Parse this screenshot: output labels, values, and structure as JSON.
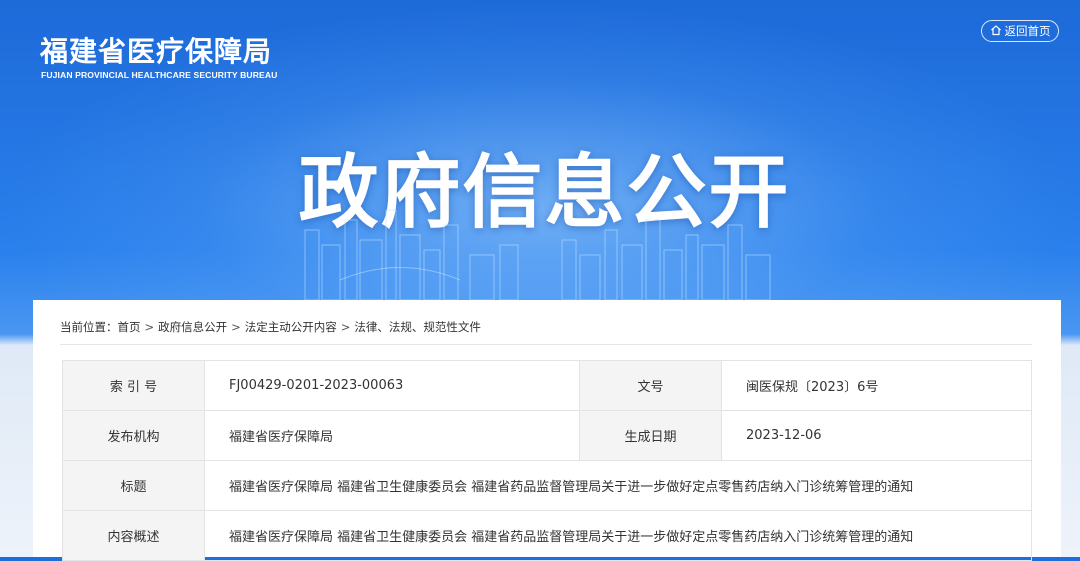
{
  "header": {
    "logo_cn": "福建省医疗保障局",
    "logo_en": "FUJIAN PROVINCIAL HEALTHCARE SECURITY BUREAU",
    "home_button": "返回首页",
    "home_icon": "home-icon"
  },
  "hero": {
    "title": "政府信息公开"
  },
  "breadcrumb": {
    "prefix": "当前位置：",
    "items": [
      "首页",
      "政府信息公开",
      "法定主动公开内容",
      "法律、法规、规范性文件"
    ],
    "separator": ">"
  },
  "meta": {
    "index_label": "索 引 号",
    "index_value": "FJ00429-0201-2023-00063",
    "docno_label": "文号",
    "docno_value": "闽医保规〔2023〕6号",
    "publisher_label": "发布机构",
    "publisher_value": "福建省医疗保障局",
    "date_label": "生成日期",
    "date_value": "2023-12-06",
    "title_label": "标题",
    "title_value": "福建省医疗保障局 福建省卫生健康委员会 福建省药品监督管理局关于进一步做好定点零售药店纳入门诊统筹管理的通知",
    "summary_label": "内容概述",
    "summary_value": "福建省医疗保障局 福建省卫生健康委员会 福建省药品监督管理局关于进一步做好定点零售药店纳入门诊统筹管理的通知"
  },
  "colors": {
    "banner_blue": "#1e6fde",
    "card_bg": "#ffffff",
    "label_bg": "#f4f4f4"
  }
}
